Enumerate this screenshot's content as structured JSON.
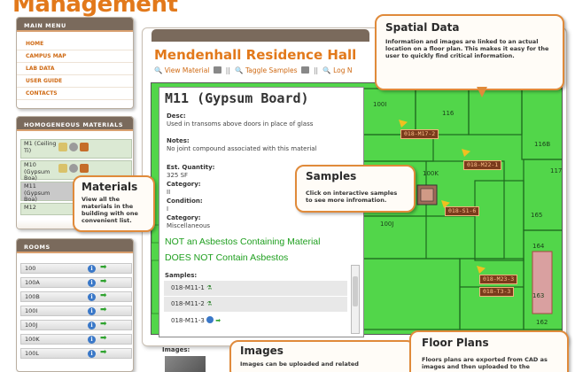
{
  "page_title": "Management",
  "main_menu": {
    "header": "MAIN MENU",
    "items": [
      "HOME",
      "CAMPUS MAP",
      "LAB DATA",
      "USER GUIDE",
      "CONTACTS"
    ]
  },
  "homogeneous_materials": {
    "header": "HOMOGENEOUS MATERIALS",
    "items": [
      "M1 (Ceiling Ti)",
      "M10 (Gypsum Boa)",
      "M11 (Gypsum Boa)",
      "M12"
    ]
  },
  "rooms": {
    "header": "ROOMS",
    "items": [
      "100",
      "100A",
      "100B",
      "100I",
      "100J",
      "100K",
      "100L"
    ]
  },
  "main": {
    "title": "Mendenhall Residence Hall",
    "actions": [
      "View Material",
      "Taggle Samples",
      "Log N"
    ]
  },
  "detail": {
    "title": "M11 (Gypsum Board)",
    "desc_label": "Desc:",
    "desc_value": "Used in transoms above doors in place of glass",
    "notes_label": "Notes:",
    "notes_value": "No joint compound associated with this material",
    "quantity_label": "Est. Quantity:",
    "quantity_value": "325 SF",
    "category_label": "Category:",
    "category_value": "II",
    "condition_label": "Condition:",
    "condition_value": "I",
    "category2_label": "Category:",
    "category2_value": "Miscellaneous",
    "asbestos_1": "NOT an Asbestos Containing Material",
    "asbestos_2": "DOES NOT Contain Asbestos",
    "samples_label": "Samples:",
    "samples": [
      "018-M11-1",
      "018-M11-2",
      "018-M11-3"
    ]
  },
  "callouts": {
    "spatial": {
      "title": "Spatial Data",
      "body": "Information and images are linked to an actual location on a floor plan.  This makes it easy for the user to quickly find critical information."
    },
    "samples": {
      "title": "Samples",
      "body": "Click on interactive samples to see more infromation."
    },
    "materials": {
      "title": "Materials",
      "body": "View all the materials in the building with one convenient list."
    },
    "images": {
      "title": "Images",
      "body": "Images can be uploaded and related"
    },
    "floor_plans": {
      "title": "Floor Plans",
      "body": "Floors plans are exported from CAD as images and then uploaded to the"
    }
  },
  "floor_plan": {
    "room_labels": [
      "100I",
      "116",
      "116B",
      "100K",
      "165",
      "117",
      "164",
      "100J",
      "163",
      "162"
    ],
    "sample_tags": [
      "018-M17-2",
      "018-M22-1",
      "018-S1-6",
      "018-M23-3",
      "018-T3-3"
    ]
  },
  "images_label": "Images:",
  "colors": {
    "accent": "#e2791b",
    "panel_header": "#7a6a5c",
    "floor_fill": "#52d64a",
    "tag_bg": "#7a3b1c",
    "asbestos_text": "#1f9f1f"
  }
}
